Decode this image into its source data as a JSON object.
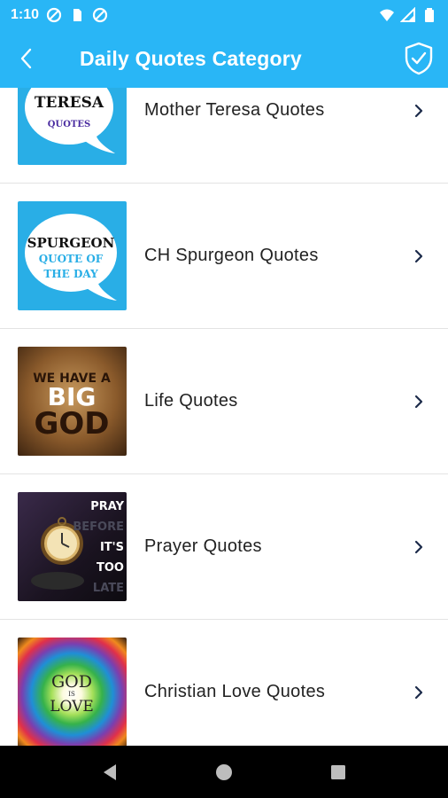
{
  "status_bar": {
    "time": "1:10",
    "icons": [
      "data-saver-icon",
      "sim-card-icon",
      "data-saver-icon",
      "wifi-icon",
      "cell-signal-icon",
      "battery-icon"
    ]
  },
  "app_bar": {
    "title": "Daily Quotes Category",
    "back_icon": "back-arrow-icon",
    "action_icon": "shield-check-icon",
    "color": "#29b6f6"
  },
  "items": [
    {
      "label": "Mother Teresa Quotes",
      "thumb_text": [
        "TERESA",
        "QUOTES"
      ],
      "chevron_icon": "chevron-right-icon"
    },
    {
      "label": "CH Spurgeon Quotes",
      "thumb_text": [
        "SPURGEON",
        "QUOTE OF",
        "THE DAY"
      ],
      "chevron_icon": "chevron-right-icon"
    },
    {
      "label": "Life Quotes",
      "thumb_text": [
        "WE HAVE A",
        "BIG",
        "GOD"
      ],
      "chevron_icon": "chevron-right-icon"
    },
    {
      "label": "Prayer Quotes",
      "thumb_text": [
        "PRAY",
        "BEFORE",
        "IT'S",
        "TOO",
        "LATE"
      ],
      "chevron_icon": "chevron-right-icon"
    },
    {
      "label": "Christian Love Quotes",
      "thumb_text": [
        "GOD",
        "IS",
        "LOVE"
      ],
      "chevron_icon": "chevron-right-icon"
    }
  ],
  "nav_bar": {
    "back": "nav-back-icon",
    "home": "nav-home-icon",
    "recents": "nav-recents-icon"
  }
}
